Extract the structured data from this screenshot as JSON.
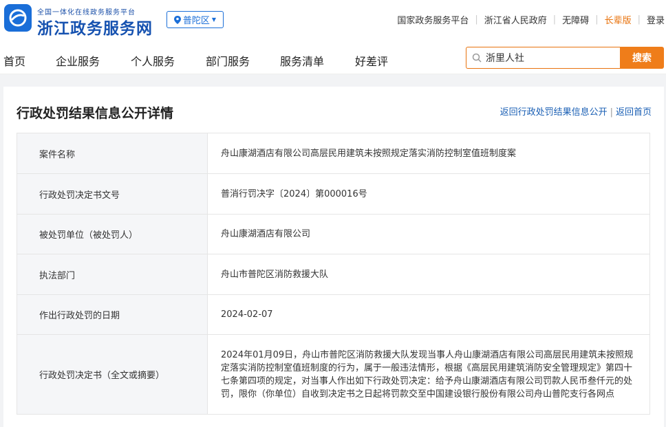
{
  "header": {
    "logo_sub": "全国一体化在线政务服务平台",
    "logo_main": "浙江政务服务网",
    "region": "普陀区",
    "links": [
      "国家政务服务平台",
      "浙江省人民政府",
      "无障碍",
      "长辈版",
      "登录"
    ]
  },
  "nav": {
    "items": [
      "首页",
      "企业服务",
      "个人服务",
      "部门服务",
      "服务清单",
      "好差评"
    ],
    "search_value": "浙里人社",
    "search_button": "搜索"
  },
  "panel": {
    "title": "行政处罚结果信息公开详情",
    "link_back_list": "返回行政处罚结果信息公开",
    "link_home": "返回首页",
    "rows": [
      {
        "label": "案件名称",
        "value": "舟山康湖酒店有限公司高层民用建筑未按照规定落实消防控制室值班制度案"
      },
      {
        "label": "行政处罚决定书文号",
        "value": "普消行罚决字〔2024〕第000016号"
      },
      {
        "label": "被处罚单位（被处罚人）",
        "value": "舟山康湖酒店有限公司"
      },
      {
        "label": "执法部门",
        "value": "舟山市普陀区消防救援大队"
      },
      {
        "label": "作出行政处罚的日期",
        "value": "2024-02-07"
      },
      {
        "label": "行政处罚决定书（全文或摘要）",
        "value": "2024年01月09日，舟山市普陀区消防救援大队发现当事人舟山康湖酒店有限公司高层民用建筑未按照规定落实消防控制室值班制度的行为，属于一般违法情形，根据《高层民用建筑消防安全管理规定》第四十七条第四项的规定，对当事人作出如下行政处罚决定：给予舟山康湖酒店有限公司罚款人民币叁仟元的处罚，限你（你单位）自收到决定书之日起将罚款交至中国建设银行股份有限公司舟山普陀支行各网点"
      }
    ]
  },
  "colors": {
    "brand_blue": "#1652b0",
    "accent_orange": "#ef7d1a",
    "link_blue": "#1a5fb4"
  }
}
